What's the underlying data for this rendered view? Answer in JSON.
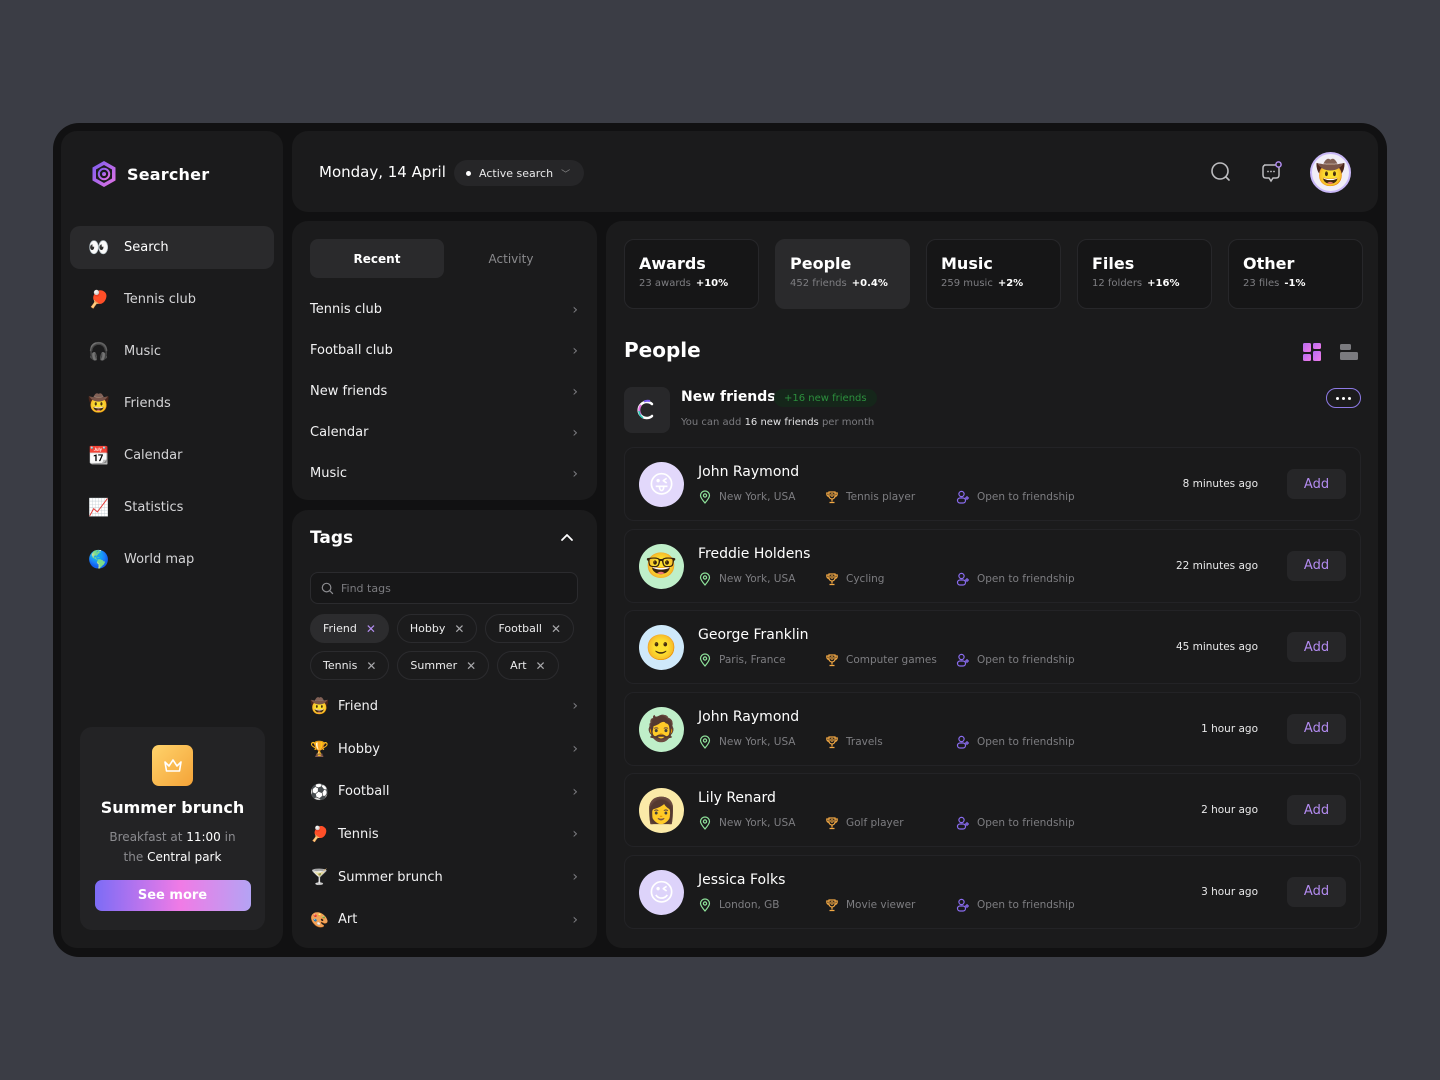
{
  "app": {
    "name": "Searcher",
    "accent": "#a77ef5"
  },
  "sidebar": {
    "items": [
      {
        "label": "Search",
        "icon": "eyes-icon",
        "glyph": "👀",
        "active": true
      },
      {
        "label": "Tennis club",
        "icon": "ping-pong-icon",
        "glyph": "🏓"
      },
      {
        "label": "Music",
        "icon": "headphones-icon",
        "glyph": "🎧"
      },
      {
        "label": "Friends",
        "icon": "cowboy-face-icon",
        "glyph": "🤠"
      },
      {
        "label": "Calendar",
        "icon": "calendar-icon",
        "glyph": "📆"
      },
      {
        "label": "Statistics",
        "icon": "chart-up-icon",
        "glyph": "📈"
      },
      {
        "label": "World map",
        "icon": "globe-icon",
        "glyph": "🌎"
      }
    ],
    "promo": {
      "title": "Summer brunch",
      "desc_1": "Breakfast at ",
      "desc_time": "11:00",
      "desc_2": " in",
      "desc_3": "the ",
      "desc_place": "Central park",
      "button": "See more"
    }
  },
  "header": {
    "date": "Monday, 14 April",
    "status": "Active search",
    "avatar_glyph": "🤠"
  },
  "recent": {
    "tabs": [
      {
        "label": "Recent",
        "active": true
      },
      {
        "label": "Activity"
      }
    ],
    "items": [
      "Tennis club",
      "Football club",
      "New friends",
      "Calendar",
      "Music"
    ]
  },
  "tags": {
    "title": "Tags",
    "search_placeholder": "Find tags",
    "chips": [
      {
        "label": "Friend",
        "active": true
      },
      {
        "label": "Hobby"
      },
      {
        "label": "Football"
      },
      {
        "label": "Tennis"
      },
      {
        "label": "Summer"
      },
      {
        "label": "Art"
      }
    ],
    "items": [
      {
        "label": "Friend",
        "glyph": "🤠",
        "icon": "cowboy-face-icon"
      },
      {
        "label": "Hobby",
        "glyph": "🏆",
        "icon": "trophy-icon"
      },
      {
        "label": "Football",
        "glyph": "⚽",
        "icon": "soccer-ball-icon"
      },
      {
        "label": "Tennis",
        "glyph": "🏓",
        "icon": "ping-pong-icon"
      },
      {
        "label": "Summer brunch",
        "glyph": "🍸",
        "icon": "cocktail-icon"
      },
      {
        "label": "Art",
        "glyph": "🎨",
        "icon": "palette-icon"
      }
    ]
  },
  "categories": [
    {
      "name": "Awards",
      "meta": "23 awards",
      "delta": "+10%"
    },
    {
      "name": "People",
      "meta": "452 friends",
      "delta": "+0.4%",
      "active": true
    },
    {
      "name": "Music",
      "meta": "259 music",
      "delta": "+2%"
    },
    {
      "name": "Files",
      "meta": "12 folders",
      "delta": "+16%"
    },
    {
      "name": "Other",
      "meta": "23 files",
      "delta": "-1%"
    }
  ],
  "people_section": {
    "title": "People",
    "new_friends": {
      "title": "New friends",
      "badge": "+16 new friends",
      "sub_1": "You can add ",
      "sub_bold": "16 new friends",
      "sub_2": " per month"
    },
    "people": [
      {
        "name": "John Raymond",
        "location": "New York, USA",
        "hobby": "Tennis player",
        "status": "Open to friendship",
        "time": "8 minutes ago",
        "action": "Add",
        "glyph": "😜",
        "bg": "#e2d8fb"
      },
      {
        "name": "Freddie Holdens",
        "location": "New York, USA",
        "hobby": "Cycling",
        "status": "Open to friendship",
        "time": "22 minutes ago",
        "action": "Add",
        "glyph": "🤓",
        "bg": "#bfefc9"
      },
      {
        "name": "George Franklin",
        "location": "Paris, France",
        "hobby": "Computer games",
        "status": "Open to friendship",
        "time": "45 minutes ago",
        "action": "Add",
        "glyph": "🙂",
        "bg": "#cfe9fa"
      },
      {
        "name": "John Raymond",
        "location": "New York, USA",
        "hobby": "Travels",
        "status": "Open to friendship",
        "time": "1 hour ago",
        "action": "Add",
        "glyph": "🧔",
        "bg": "#bfefc9"
      },
      {
        "name": "Lily Renard",
        "location": "New York, USA",
        "hobby": "Golf player",
        "status": "Open to friendship",
        "time": "2 hour ago",
        "action": "Add",
        "glyph": "👩",
        "bg": "#fbeaa8"
      },
      {
        "name": "Jessica Folks",
        "location": "London, GB",
        "hobby": "Movie viewer",
        "status": "Open to friendship",
        "time": "3 hour ago",
        "action": "Add",
        "glyph": "😉",
        "bg": "#ddd3fa"
      }
    ]
  }
}
